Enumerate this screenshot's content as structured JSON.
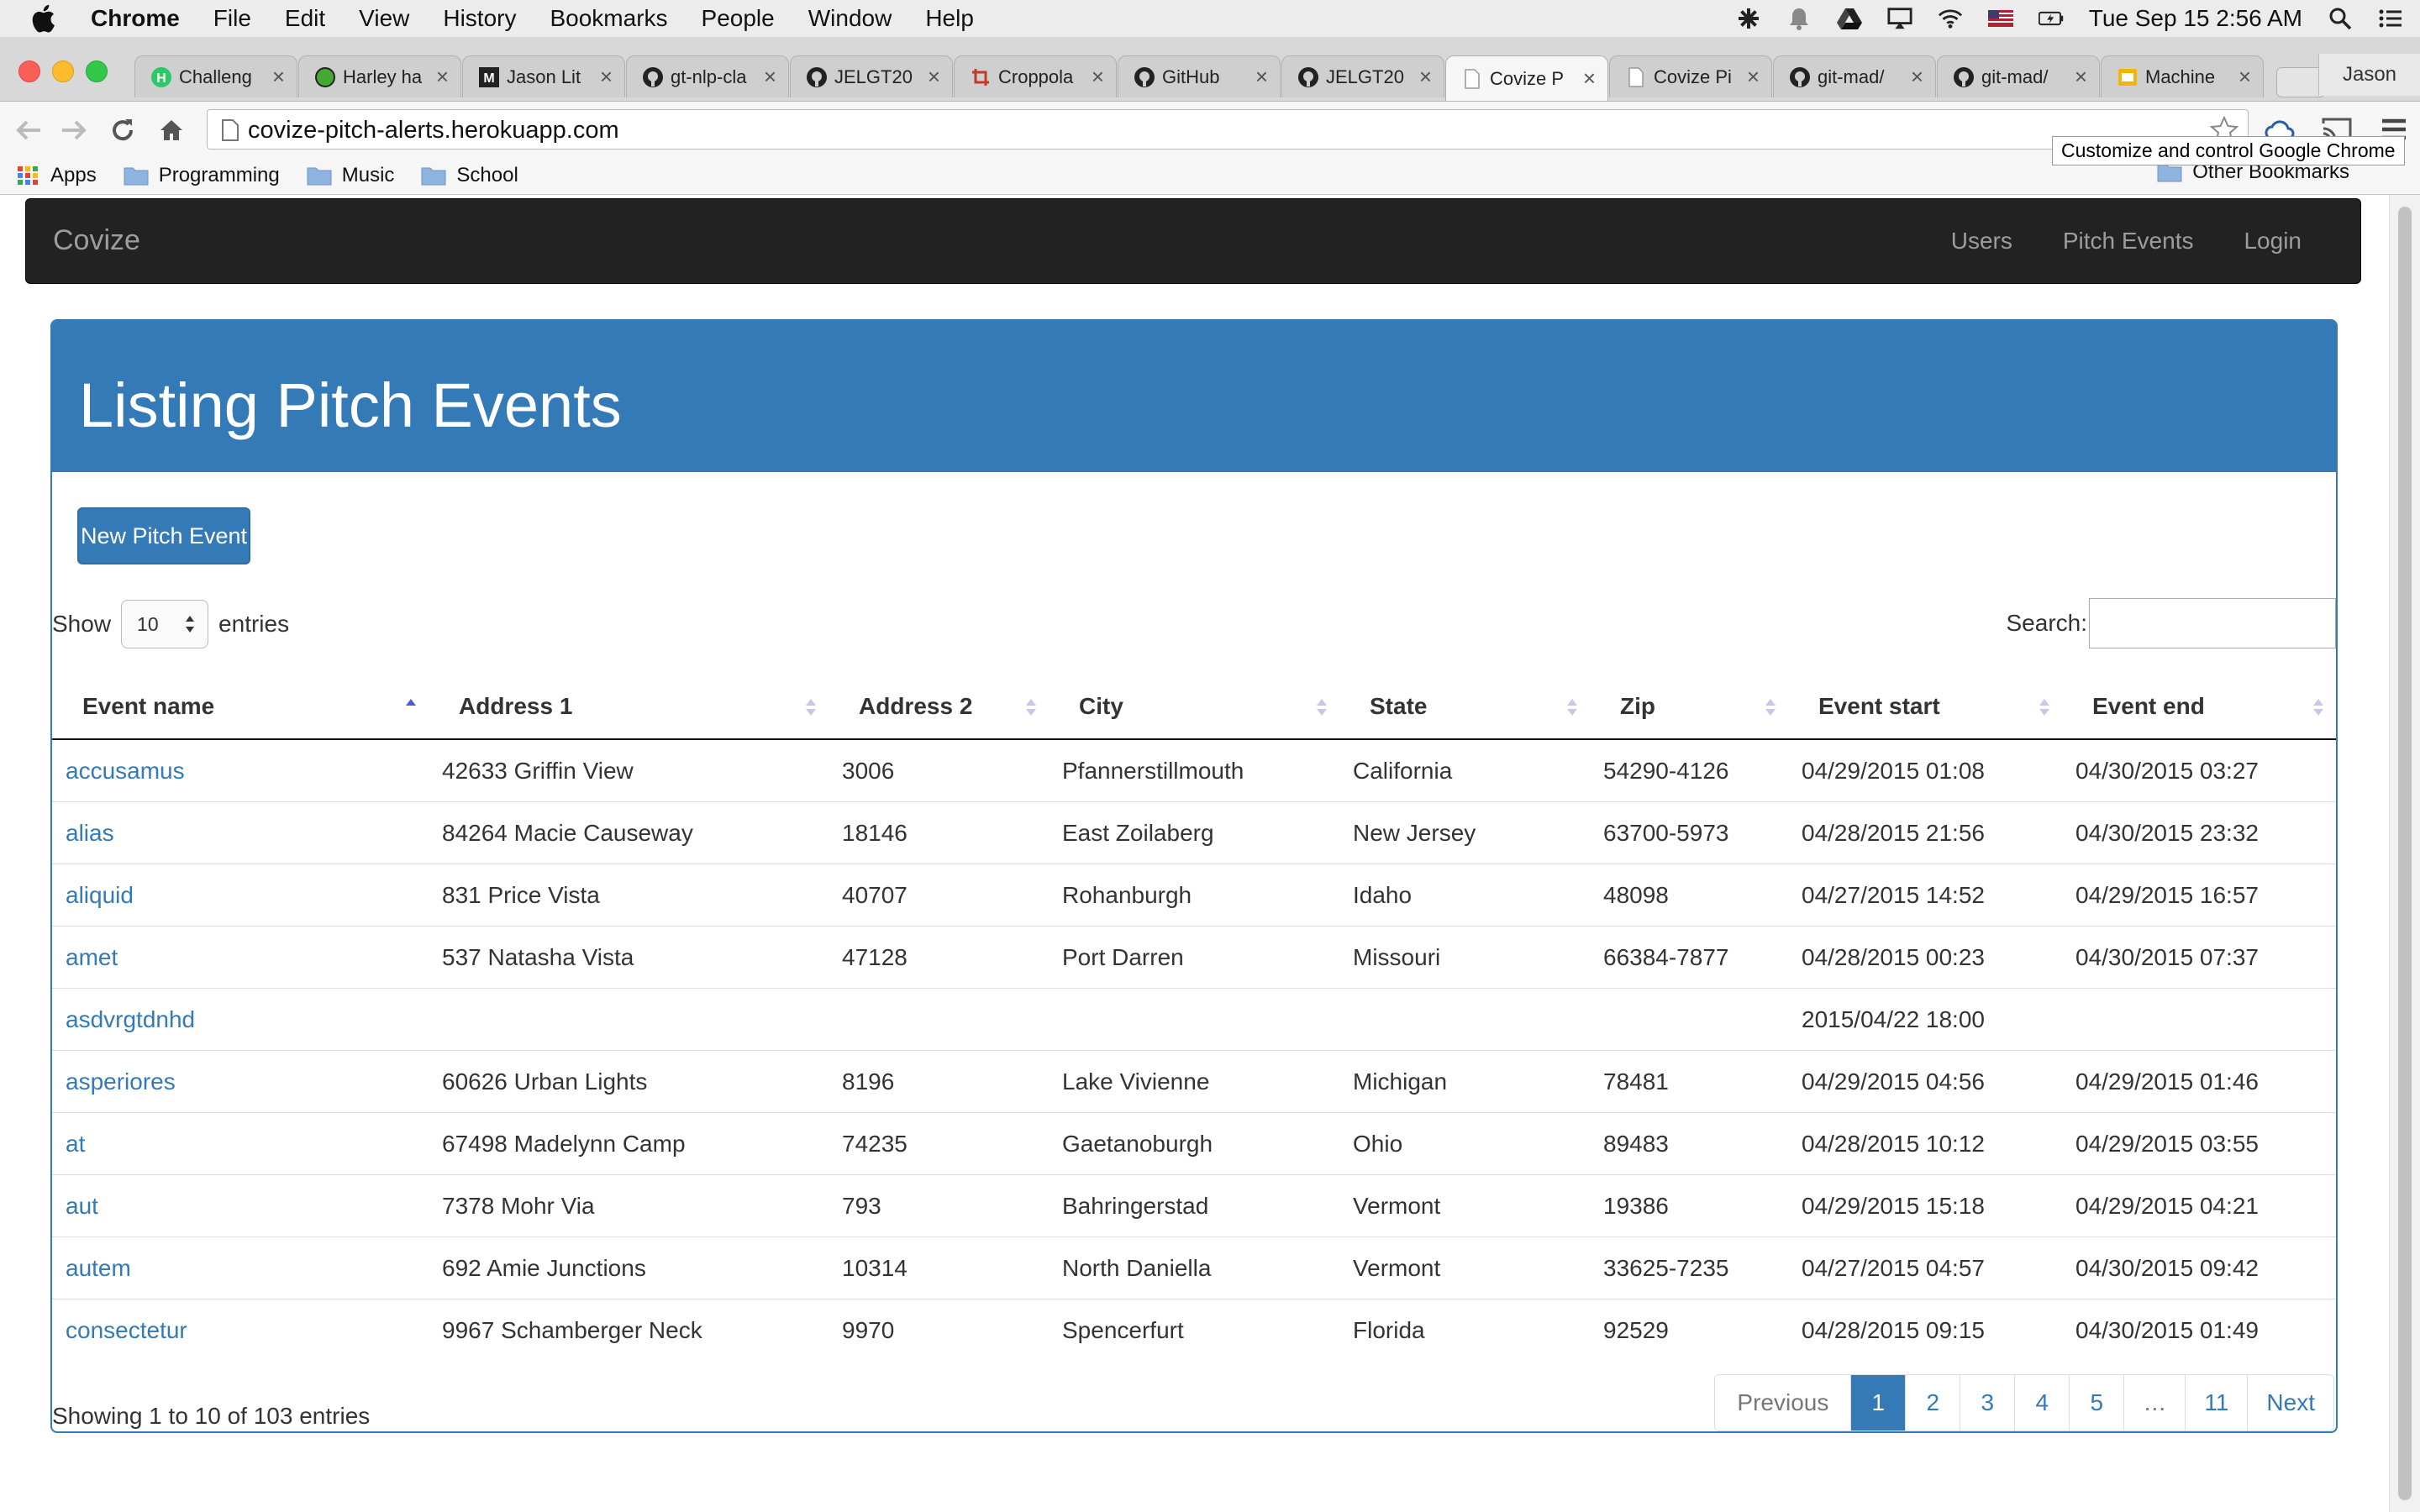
{
  "menubar": {
    "app": "Chrome",
    "items": [
      "File",
      "Edit",
      "View",
      "History",
      "Bookmarks",
      "People",
      "Window",
      "Help"
    ],
    "clock": "Tue Sep 15  2:56 AM"
  },
  "tabs": [
    {
      "title": "Challeng",
      "icon": "hackerrank-icon"
    },
    {
      "title": "Harley ha",
      "icon": "green-dot-icon"
    },
    {
      "title": "Jason Lit",
      "icon": "medium-icon"
    },
    {
      "title": "gt-nlp-cla",
      "icon": "github-icon"
    },
    {
      "title": "JELGT20",
      "icon": "github-icon"
    },
    {
      "title": "Croppola",
      "icon": "crop-icon"
    },
    {
      "title": "GitHub",
      "icon": "github-icon"
    },
    {
      "title": "JELGT20",
      "icon": "github-icon"
    },
    {
      "title": "Covize P",
      "icon": "page-icon",
      "active": true
    },
    {
      "title": "Covize Pi",
      "icon": "page-icon"
    },
    {
      "title": "git-mad/",
      "icon": "github-icon"
    },
    {
      "title": "git-mad/",
      "icon": "github-icon"
    },
    {
      "title": "Machine",
      "icon": "slides-icon"
    }
  ],
  "profile": "Jason",
  "omnibox": {
    "url": "covize-pitch-alerts.herokuapp.com"
  },
  "tooltip": "Customize and control Google Chrome",
  "bookmarks": {
    "items": [
      "Apps",
      "Programming",
      "Music",
      "School"
    ],
    "other": "Other Bookmarks"
  },
  "site": {
    "brand": "Covize",
    "nav": [
      "Users",
      "Pitch Events",
      "Login"
    ]
  },
  "panel": {
    "title": "Listing Pitch Events",
    "new_button": "New Pitch Event"
  },
  "controls": {
    "show_label": "Show",
    "entries_value": "10",
    "entries_label": "entries",
    "search_label": "Search:"
  },
  "table": {
    "columns": [
      "Event name",
      "Address 1",
      "Address 2",
      "City",
      "State",
      "Zip",
      "Event start",
      "Event end"
    ],
    "rows": [
      [
        "accusamus",
        "42633 Griffin View",
        "3006",
        "Pfannerstillmouth",
        "California",
        "54290-4126",
        "04/29/2015 01:08",
        "04/30/2015 03:27"
      ],
      [
        "alias",
        "84264 Macie Causeway",
        "18146",
        "East Zoilaberg",
        "New Jersey",
        "63700-5973",
        "04/28/2015 21:56",
        "04/30/2015 23:32"
      ],
      [
        "aliquid",
        "831 Price Vista",
        "40707",
        "Rohanburgh",
        "Idaho",
        "48098",
        "04/27/2015 14:52",
        "04/29/2015 16:57"
      ],
      [
        "amet",
        "537 Natasha Vista",
        "47128",
        "Port Darren",
        "Missouri",
        "66384-7877",
        "04/28/2015 00:23",
        "04/30/2015 07:37"
      ],
      [
        "asdvrgtdnhd",
        "",
        "",
        "",
        "",
        "",
        "2015/04/22 18:00",
        ""
      ],
      [
        "asperiores",
        "60626 Urban Lights",
        "8196",
        "Lake Vivienne",
        "Michigan",
        "78481",
        "04/29/2015 04:56",
        "04/29/2015 01:46"
      ],
      [
        "at",
        "67498 Madelynn Camp",
        "74235",
        "Gaetanoburgh",
        "Ohio",
        "89483",
        "04/28/2015 10:12",
        "04/29/2015 03:55"
      ],
      [
        "aut",
        "7378 Mohr Via",
        "793",
        "Bahringerstad",
        "Vermont",
        "19386",
        "04/29/2015 15:18",
        "04/29/2015 04:21"
      ],
      [
        "autem",
        "692 Amie Junctions",
        "10314",
        "North Daniella",
        "Vermont",
        "33625-7235",
        "04/27/2015 04:57",
        "04/30/2015 09:42"
      ],
      [
        "consectetur",
        "9967 Schamberger Neck",
        "9970",
        "Spencerfurt",
        "Florida",
        "92529",
        "04/28/2015 09:15",
        "04/30/2015 01:49"
      ]
    ]
  },
  "footer": {
    "info": "Showing 1 to 10 of 103 entries",
    "pager": [
      "Previous",
      "1",
      "2",
      "3",
      "4",
      "5",
      "…",
      "11",
      "Next"
    ],
    "active_page": "1"
  },
  "colors": {
    "primary": "#337ab7",
    "navbar": "#222222"
  }
}
